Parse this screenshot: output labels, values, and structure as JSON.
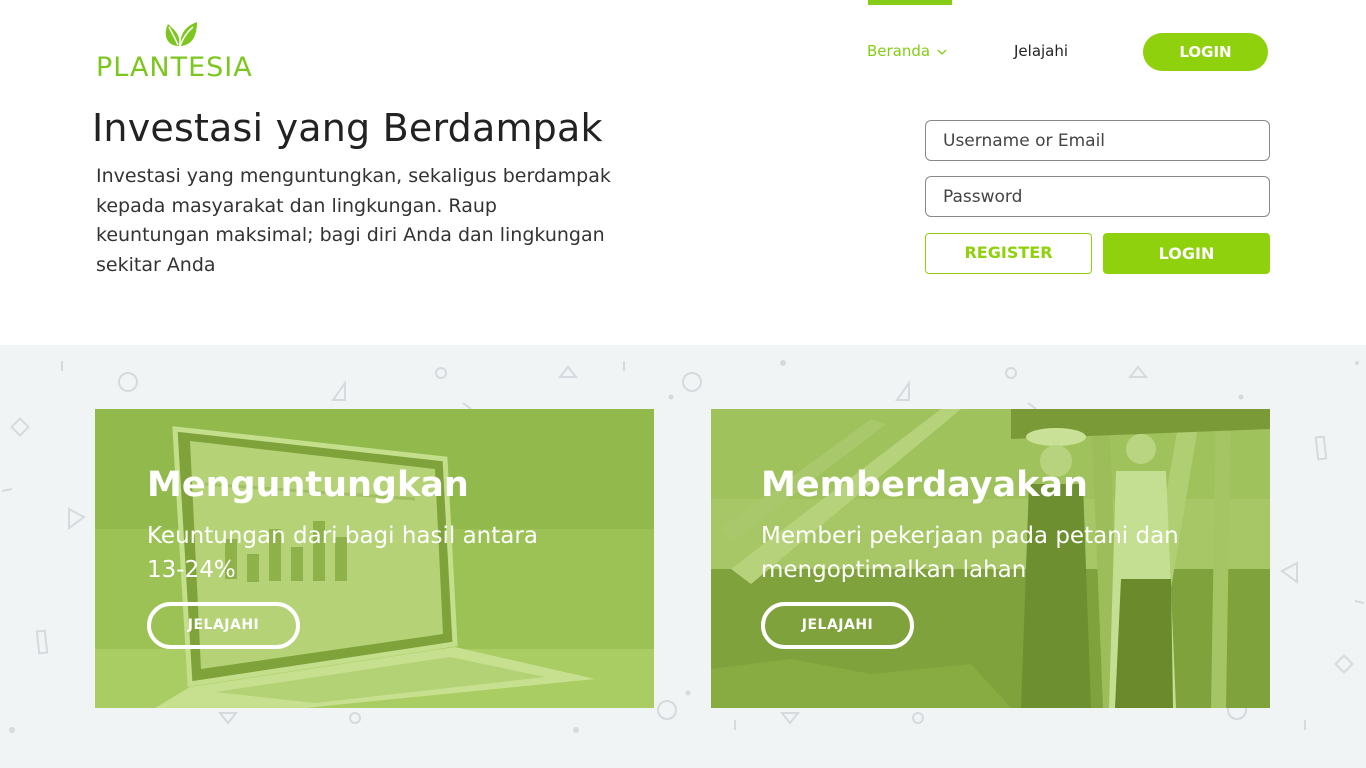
{
  "brand": {
    "name": "PLANTESIA",
    "color": "#7dc61f"
  },
  "nav": {
    "items": [
      {
        "label": "Beranda",
        "active": true
      },
      {
        "label": "Jelajahi",
        "active": false
      }
    ],
    "login_label": "LOGIN"
  },
  "hero": {
    "title": "Investasi yang Berdampak",
    "description": "Investasi yang menguntungkan, sekaligus berdampak kepada masyarakat dan lingkungan. Raup keuntungan maksimal; bagi diri Anda dan lingkungan sekitar Anda"
  },
  "form": {
    "username_placeholder": "Username or Email",
    "password_placeholder": "Password",
    "register_label": "REGISTER",
    "login_label": "LOGIN"
  },
  "cards": [
    {
      "title": "Menguntungkan",
      "text": "Keuntungan dari bagi hasil antara 13-24%",
      "button": "JELAJAHI"
    },
    {
      "title": "Memberdayakan",
      "text": "Memberi pekerjaan pada petani dan mengoptimalkan lahan",
      "button": "JELAJAHI"
    }
  ],
  "colors": {
    "accent": "#8fd10c",
    "section_bg": "#f1f4f5"
  }
}
